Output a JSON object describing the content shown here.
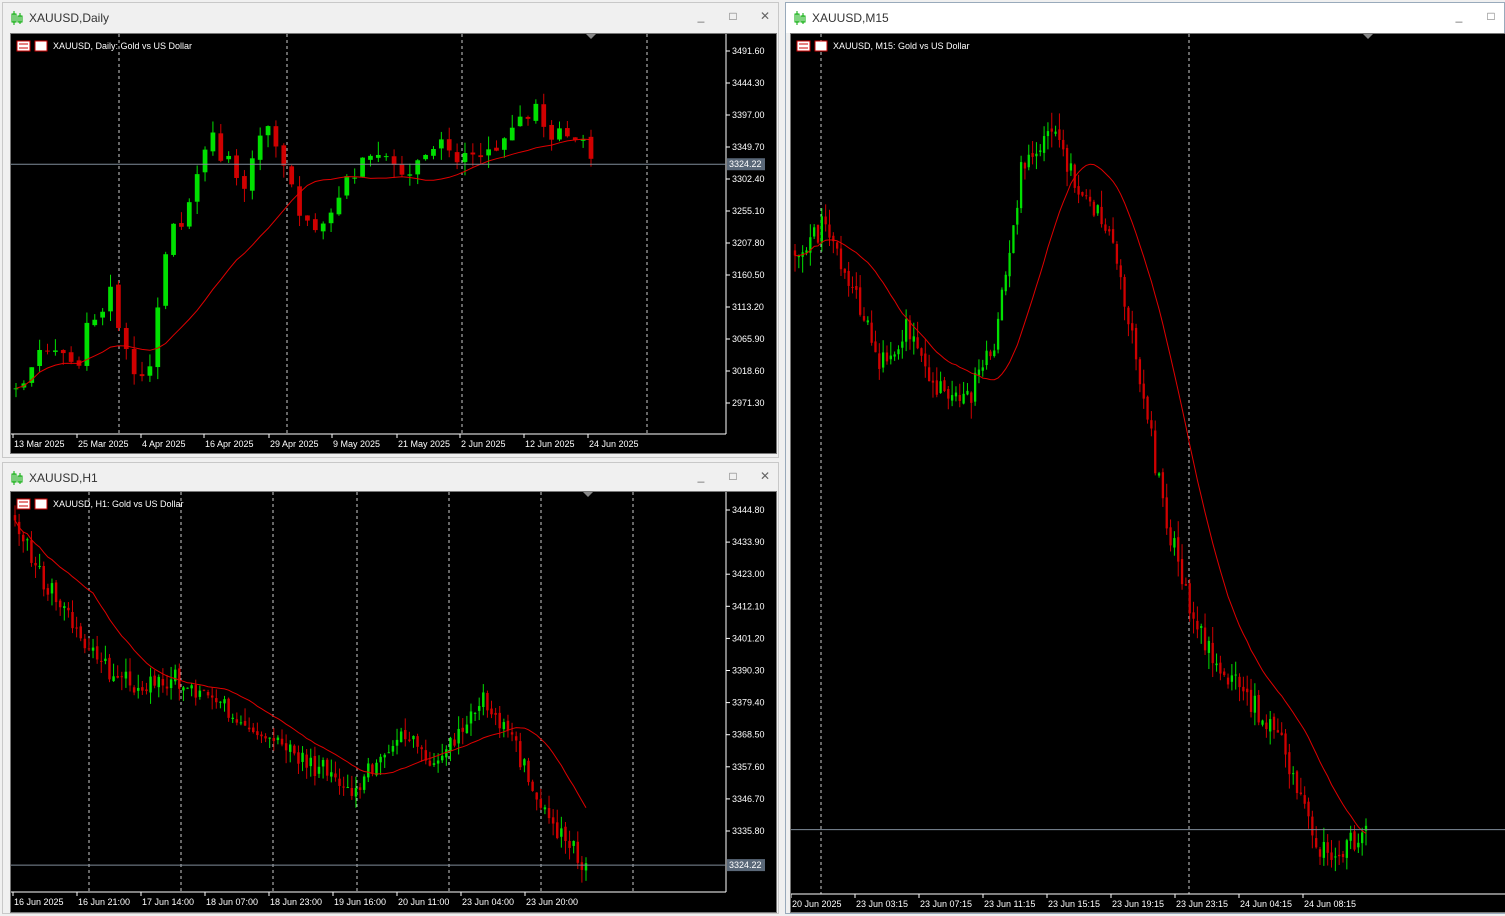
{
  "colors": {
    "bull": "#00e000",
    "bear": "#d00000",
    "ma": "#e00000",
    "grid": "#ffffff",
    "axis": "#ffffff",
    "bg": "#000000",
    "priceline": "#7f8c99"
  },
  "windows": {
    "daily": {
      "title": "XAUUSD,Daily",
      "label": "XAUUSD, Daily:  Gold vs US Dollar",
      "y_ticks": [
        "3491.60",
        "3444.30",
        "3397.00",
        "3349.70",
        "3302.40",
        "3255.10",
        "3207.80",
        "3160.50",
        "3113.20",
        "3065.90",
        "3018.60",
        "2971.30"
      ],
      "x_ticks": [
        "13 Mar 2025",
        "25 Mar 2025",
        "4 Apr 2025",
        "16 Apr 2025",
        "29 Apr 2025",
        "9 May 2025",
        "21 May 2025",
        "2 Jun 2025",
        "12 Jun 2025",
        "24 Jun 2025"
      ],
      "price_tag": "3324.22"
    },
    "h1": {
      "title": "XAUUSD,H1",
      "label": "XAUUSD, H1:  Gold vs US Dollar",
      "y_ticks": [
        "3444.80",
        "3433.90",
        "3423.00",
        "3412.10",
        "3401.20",
        "3390.30",
        "3379.40",
        "3368.50",
        "3357.60",
        "3346.70",
        "3335.80"
      ],
      "x_ticks": [
        "16 Jun 2025",
        "16 Jun 21:00",
        "17 Jun 14:00",
        "18 Jun 07:00",
        "18 Jun 23:00",
        "19 Jun 16:00",
        "20 Jun 11:00",
        "23 Jun 04:00",
        "23 Jun 20:00"
      ],
      "price_tag": "3324.22"
    },
    "m15": {
      "title": "XAUUSD,M15",
      "label": "XAUUSD, M15:  Gold vs US Dollar",
      "x_ticks": [
        "20 Jun 2025",
        "23 Jun 03:15",
        "23 Jun 07:15",
        "23 Jun 11:15",
        "23 Jun 15:15",
        "23 Jun 19:15",
        "23 Jun 23:15",
        "24 Jun 04:15",
        "24 Jun 08:15"
      ]
    }
  },
  "buttons": {
    "minimize": "_",
    "maximize": "□",
    "close": "✕"
  },
  "icons": {
    "window": "candle-chart-icon",
    "flag": "us-flag-icon",
    "trade": "one-click-trading-icon"
  }
}
